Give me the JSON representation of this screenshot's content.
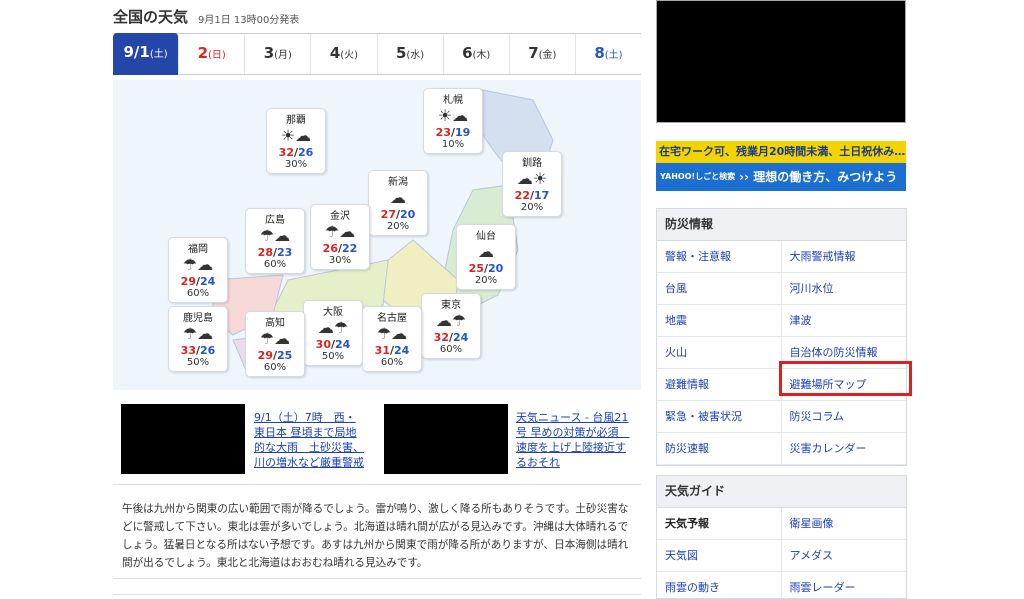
{
  "header": {
    "title": "全国の天気",
    "published": "9月1日 13時00分発表"
  },
  "tabs": [
    {
      "date": "9/1",
      "dow": "(土)"
    },
    {
      "date": "2",
      "dow": "(日)"
    },
    {
      "date": "3",
      "dow": "(月)"
    },
    {
      "date": "4",
      "dow": "(火)"
    },
    {
      "date": "5",
      "dow": "(水)"
    },
    {
      "date": "6",
      "dow": "(木)"
    },
    {
      "date": "7",
      "dow": "(金)"
    },
    {
      "date": "8",
      "dow": "(土)"
    }
  ],
  "cities": [
    {
      "name": "札幌",
      "icon": "sun-cloud-icon",
      "high": "23",
      "low": "19",
      "pop": "10%"
    },
    {
      "name": "那覇",
      "icon": "sun-cloud-icon",
      "high": "32",
      "low": "26",
      "pop": "30%"
    },
    {
      "name": "釧路",
      "icon": "cloud-sun-icon",
      "high": "22",
      "low": "17",
      "pop": "20%"
    },
    {
      "name": "新潟",
      "icon": "cloud-icon",
      "high": "27",
      "low": "20",
      "pop": "20%"
    },
    {
      "name": "金沢",
      "icon": "rain-cloud-icon",
      "high": "26",
      "low": "22",
      "pop": "30%"
    },
    {
      "name": "広島",
      "icon": "rain-cloud-icon",
      "high": "28",
      "low": "23",
      "pop": "60%"
    },
    {
      "name": "仙台",
      "icon": "cloud-icon",
      "high": "25",
      "low": "20",
      "pop": "20%"
    },
    {
      "name": "福岡",
      "icon": "rain-cloud-icon",
      "high": "29",
      "low": "24",
      "pop": "60%"
    },
    {
      "name": "東京",
      "icon": "cloud-rain-icon",
      "high": "32",
      "low": "24",
      "pop": "60%"
    },
    {
      "name": "鹿児島",
      "icon": "rain-cloud-icon",
      "high": "33",
      "low": "26",
      "pop": "50%"
    },
    {
      "name": "大阪",
      "icon": "cloud-rain-icon",
      "high": "30",
      "low": "24",
      "pop": "50%"
    },
    {
      "name": "高知",
      "icon": "rain-cloud-icon",
      "high": "29",
      "low": "25",
      "pop": "60%"
    },
    {
      "name": "名古屋",
      "icon": "rain-cloud-icon",
      "high": "31",
      "low": "24",
      "pop": "60%"
    }
  ],
  "news": [
    {
      "text": "9/1（土）7時　西・東日本 昼頃まで局地的な大雨　土砂災害、川の増水など厳重警戒"
    },
    {
      "text": "天気ニュース - 台風21号 早めの対策が必須　速度を上げ上陸接近するおそれ"
    }
  ],
  "description": "午後は九州から関東の広い範囲で雨が降るでしょう。雷が鳴り、激しく降る所もありそうです。土砂災害などに警戒して下さい。東北は雲が多いでしょう。北海道は晴れ間が広がる見込みです。沖縄は大体晴れるでしょう。猛暑日となる所はない予想です。あすは九州から関東で雨が降る所がありますが、日本海側は晴れ間が出るでしょう。東北と北海道はおおむね晴れる見込みです。",
  "banner": {
    "line1": "在宅ワーク可、残業月20時間未満、土日祝休み…",
    "logo": "YAHOO!しごと検索",
    "line2": "›› 理想の働き方、みつけよう"
  },
  "bousai": {
    "heading": "防災情報",
    "items": [
      "警報・注意報",
      "大雨警戒情報",
      "台風",
      "河川水位",
      "地震",
      "津波",
      "火山",
      "自治体の防災情報",
      "避難情報",
      "避難場所マップ",
      "緊急・被害状況",
      "防災コラム",
      "防災速報",
      "災害カレンダー"
    ]
  },
  "guide": {
    "heading": "天気ガイド",
    "items": [
      "天気予報",
      "衛星画像",
      "天気図",
      "アメダス",
      "雨雲の動き",
      "雨雲レーダー"
    ]
  },
  "colors": {
    "accent": "#2446a8",
    "high": "#dd2222",
    "low": "#2255cc",
    "highlight": "#e02020"
  }
}
